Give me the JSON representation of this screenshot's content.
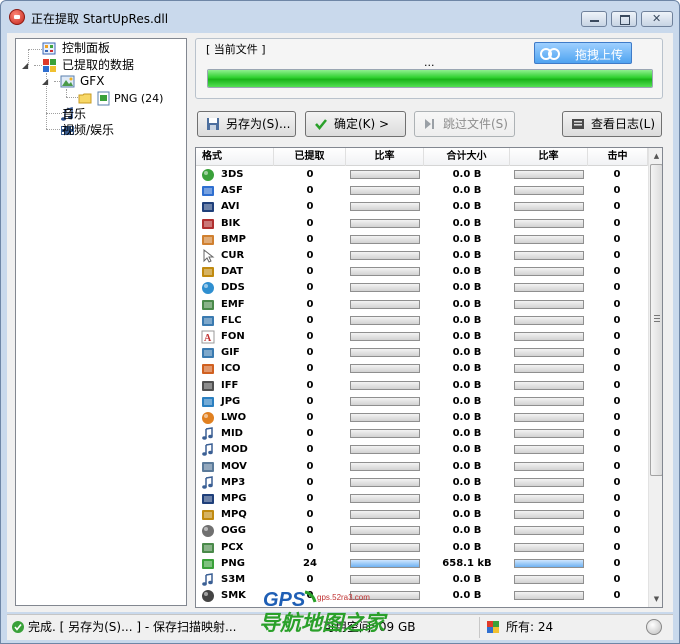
{
  "window": {
    "title": "正在提取 StartUpRes.dll"
  },
  "tree": {
    "items": [
      {
        "label": "控制面板",
        "icon": "control-panel-icon"
      },
      {
        "label": "已提取的数据",
        "icon": "extracted-data-icon"
      },
      {
        "label": "GFX",
        "icon": "gfx-icon"
      },
      {
        "label": "PNG (24)",
        "icon": "png-folder-icon"
      },
      {
        "label": "音乐",
        "icon": "music-icon"
      },
      {
        "label": "视频/娱乐",
        "icon": "video-icon"
      }
    ]
  },
  "current_file": {
    "label": "[ 当前文件 ]",
    "value": "...",
    "progress_percent": 100,
    "upload_label": "拖拽上传"
  },
  "toolbar": {
    "save_as": "另存为(S)...",
    "ok": "确定(K) >",
    "skip": "跳过文件(S)",
    "log": "查看日志(L)"
  },
  "table": {
    "headers": [
      "格式",
      "已提取",
      "比率",
      "合计大小",
      "比率",
      "击中"
    ],
    "rows": [
      {
        "format": "3DS",
        "count": "0",
        "size": "0.0 B",
        "hits": "0",
        "ratio1": 0,
        "ratio2": 0,
        "icon": "3ds-icon"
      },
      {
        "format": "ASF",
        "count": "0",
        "size": "0.0 B",
        "hits": "0",
        "ratio1": 0,
        "ratio2": 0,
        "icon": "asf-icon"
      },
      {
        "format": "AVI",
        "count": "0",
        "size": "0.0 B",
        "hits": "0",
        "ratio1": 0,
        "ratio2": 0,
        "icon": "avi-icon"
      },
      {
        "format": "BIK",
        "count": "0",
        "size": "0.0 B",
        "hits": "0",
        "ratio1": 0,
        "ratio2": 0,
        "icon": "bik-icon"
      },
      {
        "format": "BMP",
        "count": "0",
        "size": "0.0 B",
        "hits": "0",
        "ratio1": 0,
        "ratio2": 0,
        "icon": "bmp-icon"
      },
      {
        "format": "CUR",
        "count": "0",
        "size": "0.0 B",
        "hits": "0",
        "ratio1": 0,
        "ratio2": 0,
        "icon": "cursor-icon"
      },
      {
        "format": "DAT",
        "count": "0",
        "size": "0.0 B",
        "hits": "0",
        "ratio1": 0,
        "ratio2": 0,
        "icon": "dat-icon"
      },
      {
        "format": "DDS",
        "count": "0",
        "size": "0.0 B",
        "hits": "0",
        "ratio1": 0,
        "ratio2": 0,
        "icon": "dds-icon"
      },
      {
        "format": "EMF",
        "count": "0",
        "size": "0.0 B",
        "hits": "0",
        "ratio1": 0,
        "ratio2": 0,
        "icon": "emf-icon"
      },
      {
        "format": "FLC",
        "count": "0",
        "size": "0.0 B",
        "hits": "0",
        "ratio1": 0,
        "ratio2": 0,
        "icon": "flc-icon"
      },
      {
        "format": "FON",
        "count": "0",
        "size": "0.0 B",
        "hits": "0",
        "ratio1": 0,
        "ratio2": 0,
        "icon": "font-icon"
      },
      {
        "format": "GIF",
        "count": "0",
        "size": "0.0 B",
        "hits": "0",
        "ratio1": 0,
        "ratio2": 0,
        "icon": "gif-icon"
      },
      {
        "format": "ICO",
        "count": "0",
        "size": "0.0 B",
        "hits": "0",
        "ratio1": 0,
        "ratio2": 0,
        "icon": "ico-icon"
      },
      {
        "format": "IFF",
        "count": "0",
        "size": "0.0 B",
        "hits": "0",
        "ratio1": 0,
        "ratio2": 0,
        "icon": "iff-icon"
      },
      {
        "format": "JPG",
        "count": "0",
        "size": "0.0 B",
        "hits": "0",
        "ratio1": 0,
        "ratio2": 0,
        "icon": "jpg-icon"
      },
      {
        "format": "LWO",
        "count": "0",
        "size": "0.0 B",
        "hits": "0",
        "ratio1": 0,
        "ratio2": 0,
        "icon": "lwo-icon"
      },
      {
        "format": "MID",
        "count": "0",
        "size": "0.0 B",
        "hits": "0",
        "ratio1": 0,
        "ratio2": 0,
        "icon": "midi-icon"
      },
      {
        "format": "MOD",
        "count": "0",
        "size": "0.0 B",
        "hits": "0",
        "ratio1": 0,
        "ratio2": 0,
        "icon": "mod-icon"
      },
      {
        "format": "MOV",
        "count": "0",
        "size": "0.0 B",
        "hits": "0",
        "ratio1": 0,
        "ratio2": 0,
        "icon": "mov-icon"
      },
      {
        "format": "MP3",
        "count": "0",
        "size": "0.0 B",
        "hits": "0",
        "ratio1": 0,
        "ratio2": 0,
        "icon": "mp3-icon"
      },
      {
        "format": "MPG",
        "count": "0",
        "size": "0.0 B",
        "hits": "0",
        "ratio1": 0,
        "ratio2": 0,
        "icon": "mpg-icon"
      },
      {
        "format": "MPQ",
        "count": "0",
        "size": "0.0 B",
        "hits": "0",
        "ratio1": 0,
        "ratio2": 0,
        "icon": "mpq-icon"
      },
      {
        "format": "OGG",
        "count": "0",
        "size": "0.0 B",
        "hits": "0",
        "ratio1": 0,
        "ratio2": 0,
        "icon": "ogg-icon"
      },
      {
        "format": "PCX",
        "count": "0",
        "size": "0.0 B",
        "hits": "0",
        "ratio1": 0,
        "ratio2": 0,
        "icon": "pcx-icon"
      },
      {
        "format": "PNG",
        "count": "24",
        "size": "658.1 kB",
        "hits": "0",
        "ratio1": 1,
        "ratio2": 1,
        "icon": "png-icon"
      },
      {
        "format": "S3M",
        "count": "0",
        "size": "0.0 B",
        "hits": "0",
        "ratio1": 0,
        "ratio2": 0,
        "icon": "s3m-icon"
      },
      {
        "format": "SMK",
        "count": "0",
        "size": "0.0 B",
        "hits": "0",
        "ratio1": 0,
        "ratio2": 0,
        "icon": "smk-icon"
      }
    ]
  },
  "status": {
    "message": "完成. [ 另存为(S)... ] - 保存扫描映射...",
    "disk": "可用空间: 09 GB",
    "total": "所有: 24"
  }
}
